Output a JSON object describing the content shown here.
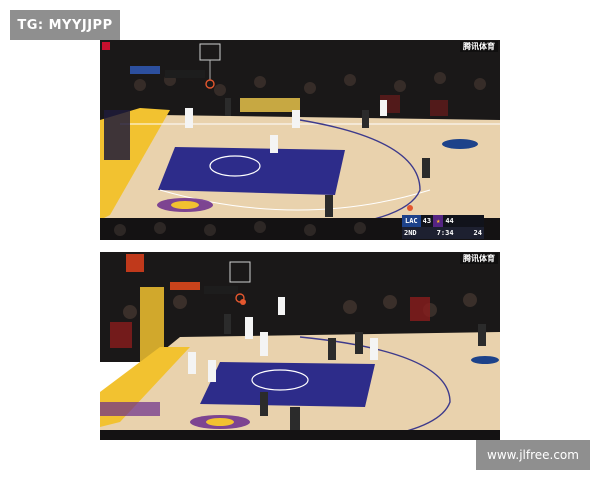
{
  "overlay": {
    "tag_text": "TG: MYYJJPP",
    "watermark_text": "www.jlfree.com"
  },
  "broadcast": {
    "corner_text": "腾讯体育",
    "score": {
      "away_team": "LAC",
      "away_score": "43",
      "home_score": "44",
      "period": "2ND",
      "clock": "7:34",
      "shot_clock": "24"
    }
  },
  "colors": {
    "court_wood": "#e9d2ad",
    "paint_blue": "#2d2c8a",
    "sideline_gold": "#f2c230",
    "crowd_dark": "#1a1818"
  }
}
